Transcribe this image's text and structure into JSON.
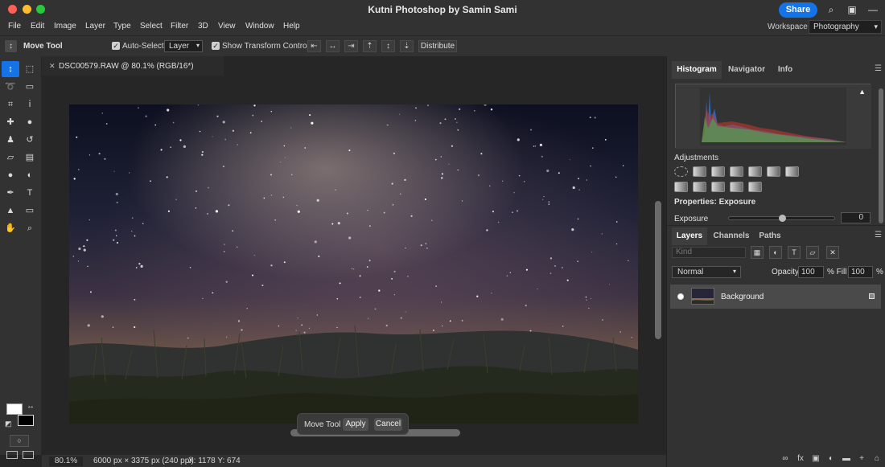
{
  "app": {
    "title": "Kutni Photoshop by Samin Sami",
    "share_label": "Share"
  },
  "menu": [
    "File",
    "Edit",
    "Image",
    "Layer",
    "Type",
    "Select",
    "Filter",
    "3D",
    "View",
    "Window",
    "Help"
  ],
  "workspace": {
    "label": "Workspace",
    "value": "Photography"
  },
  "options": {
    "tool_name": "Move Tool",
    "auto_select_label": "Auto-Select:",
    "auto_select_value": "Layer",
    "show_transform_label": "Show Transform Controls",
    "distribute_label": "Distribute"
  },
  "document": {
    "tab_title": "DSC00579.RAW  @  80.1%  (RGB/16*)"
  },
  "popup": {
    "label": "Move Tool",
    "apply": "Apply",
    "cancel": "Cancel"
  },
  "status": {
    "zoom": "80.1%",
    "dimensions": "6000 px × 3375 px (240 ppi)",
    "coords": "X: 1178 Y: 674"
  },
  "panels": {
    "top_tabs": [
      "Histogram",
      "Navigator",
      "Info"
    ],
    "adjustments_title": "Adjustments",
    "properties_title": "Properties: Exposure",
    "exposure_label": "Exposure",
    "exposure_value": "0",
    "exposure_slider_fraction": 0.5,
    "layers_tabs": [
      "Layers",
      "Channels",
      "Paths"
    ],
    "kind_placeholder": "Kind",
    "blend_mode": "Normal",
    "opacity_label": "Opacity",
    "opacity_value": "100",
    "fill_label": "% Fill",
    "fill_value": "100",
    "percent": "%",
    "layers": [
      {
        "name": "Background"
      }
    ]
  }
}
